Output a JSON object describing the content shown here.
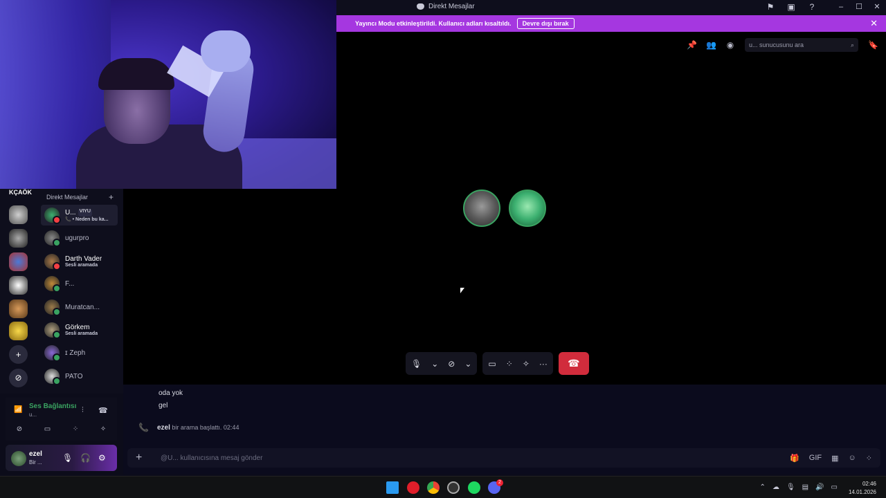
{
  "window": {
    "title": "Direkt Mesajlar"
  },
  "banner": {
    "message": "Yayıncı Modu etkinleştirildi. Kullanıcı adları kısaltıldı.",
    "button": "Devre dışı bırak"
  },
  "search": {
    "placeholder": "u... sunucusunu ara"
  },
  "servers": {
    "top_label": "KÇAÖK"
  },
  "dm_list": {
    "header": "Direkt Mesajlar",
    "items": [
      {
        "name": "U...",
        "badge": "VIYU",
        "sub": "📞 • Neden bu ka...",
        "status_color": "#f23f43",
        "active": true
      },
      {
        "name": "ugurpro",
        "sub": "",
        "status_color": "#3aa361",
        "active": false
      },
      {
        "name": "Darth Vader",
        "sub": "Sesli aramada",
        "status_color": "#f23f43",
        "active": false
      },
      {
        "name": "F...",
        "sub": "",
        "status_color": "#3aa361",
        "active": false
      },
      {
        "name": "Muratcan...",
        "sub": "",
        "status_color": "#3aa361",
        "active": false
      },
      {
        "name": "Görkem",
        "sub": "Sesli aramada",
        "status_color": "#3aa361",
        "active": false
      },
      {
        "name": "ɪ Zeph",
        "sub": "",
        "status_color": "#3aa361",
        "active": false
      },
      {
        "name": "PATO",
        "sub": "",
        "status_color": "#3aa361",
        "active": false
      }
    ]
  },
  "voice": {
    "title": "Ses Bağlantısı",
    "subtitle": "u..."
  },
  "user": {
    "name": "ezel",
    "status": "Bir ..."
  },
  "chat": {
    "messages": [
      "oda yok",
      "gel"
    ],
    "call_event_user": "ezel",
    "call_event_text": "bir arama başlattı.",
    "call_event_time": "02:44",
    "composer_placeholder": "@U... kullanıcısına mesaj gönder"
  },
  "taskbar": {
    "time": "02:46",
    "date": "14.01.2026",
    "discord_badge": "2"
  },
  "colors": {
    "banner": "#a537e0",
    "online": "#3aa361",
    "hangup": "#d12c3c"
  }
}
